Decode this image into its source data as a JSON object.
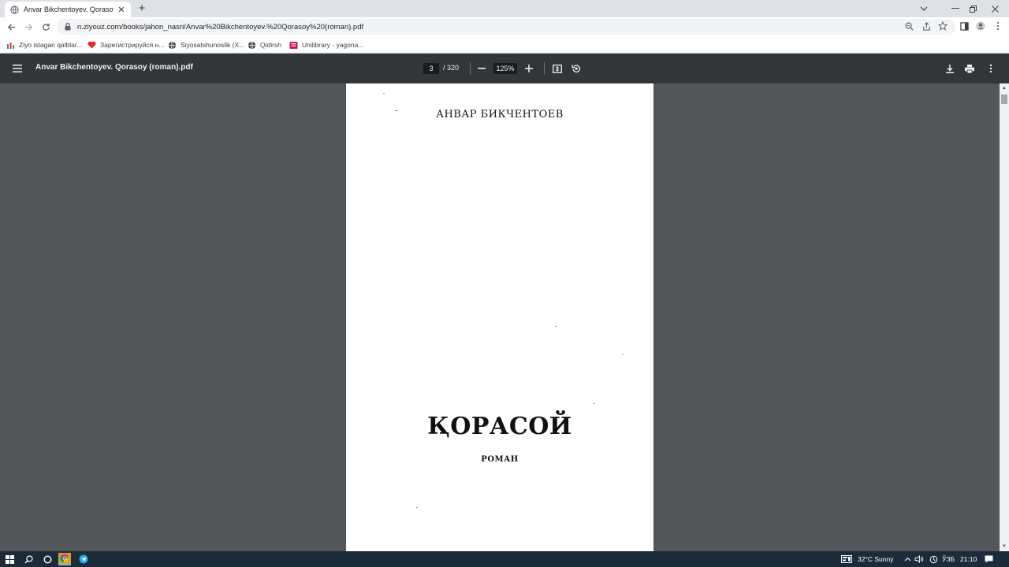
{
  "browser": {
    "tab_title": "Anvar Bikchentoyev. Qorasoy (ro",
    "tab_close": "✕",
    "new_tab": "+",
    "url": "n.ziyouz.com/books/jahon_nasri/Anvar%20Bikchentoyev.%20Qorasoy%20(roman).pdf",
    "bookmarks": [
      {
        "label": "Ziyo istagan qalblar...",
        "icon_color": "#4a7fc1"
      },
      {
        "label": "Зарегистрируйся н...",
        "icon_color": "#d93025"
      },
      {
        "label": "Siyosatshunoslik (X...",
        "icon_color": "#3c4043"
      },
      {
        "label": "Qidirsh",
        "icon_color": "#3c4043"
      },
      {
        "label": "Unilibrary - yagona...",
        "icon_color": "#c2185b"
      }
    ]
  },
  "pdf_toolbar": {
    "file_title": "Anvar Bikchentoyev. Qorasoy (roman).pdf",
    "current_page": "3",
    "total_pages": "/ 320",
    "zoom": "125%"
  },
  "page_content": {
    "author": "АНВАР БИКЧЕНТОЕВ",
    "title": "ҚОРАСОЙ",
    "genre": "РОМАН"
  },
  "taskbar": {
    "weather": "32°C  Sunny",
    "language": "ЎЗБ",
    "time": "21:10"
  },
  "colors": {
    "pdf_toolbar_bg": "#323639",
    "viewer_bg": "#525659",
    "taskbar_bg": "#1c2b3a"
  }
}
